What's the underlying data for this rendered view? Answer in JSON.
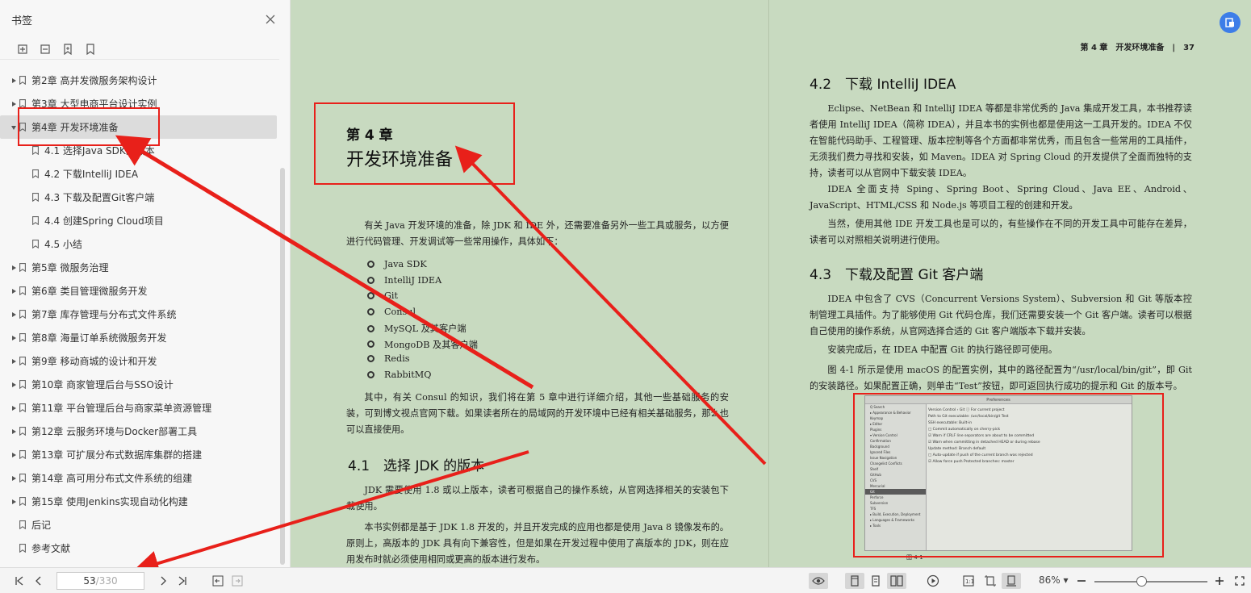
{
  "sidebar": {
    "title": "书签",
    "items": [
      {
        "label": "第2章 高并发微服务架构设计",
        "level": 0,
        "expandable": true
      },
      {
        "label": "第3章 大型电商平台设计实例",
        "level": 0,
        "expandable": true
      },
      {
        "label": "第4章 开发环境准备",
        "level": 0,
        "expandable": true,
        "expanded": true,
        "active": true
      },
      {
        "label": "4.1 选择Java SDK的版本",
        "level": 1
      },
      {
        "label": "4.2 下载IntelliJ IDEA",
        "level": 1
      },
      {
        "label": "4.3 下载及配置Git客户端",
        "level": 1
      },
      {
        "label": "4.4 创建Spring Cloud项目",
        "level": 1
      },
      {
        "label": "4.5 小结",
        "level": 1
      },
      {
        "label": "第5章 微服务治理",
        "level": 0,
        "expandable": true
      },
      {
        "label": "第6章 类目管理微服务开发",
        "level": 0,
        "expandable": true
      },
      {
        "label": "第7章 库存管理与分布式文件系统",
        "level": 0,
        "expandable": true
      },
      {
        "label": "第8章 海量订单系统微服务开发",
        "level": 0,
        "expandable": true
      },
      {
        "label": "第9章 移动商城的设计和开发",
        "level": 0,
        "expandable": true
      },
      {
        "label": "第10章 商家管理后台与SSO设计",
        "level": 0,
        "expandable": true
      },
      {
        "label": "第11章 平台管理后台与商家菜单资源管理",
        "level": 0,
        "expandable": true
      },
      {
        "label": "第12章 云服务环境与Docker部署工具",
        "level": 0,
        "expandable": true
      },
      {
        "label": "第13章 可扩展分布式数据库集群的搭建",
        "level": 0,
        "expandable": true
      },
      {
        "label": "第14章 高可用分布式文件系统的组建",
        "level": 0,
        "expandable": true
      },
      {
        "label": "第15章 使用Jenkins实现自动化构建",
        "level": 0,
        "expandable": true
      },
      {
        "label": "后记",
        "level": 0,
        "expandable": false
      },
      {
        "label": "参考文献",
        "level": 0,
        "expandable": false
      }
    ]
  },
  "left_page": {
    "chapter_number": "第 4 章",
    "chapter_title": "开发环境准备",
    "intro": "有关 Java 开发环境的准备，除 JDK 和 IDE 外，还需要准备另外一些工具或服务，以方便进行代码管理、开发调试等一些常用操作，具体如下：",
    "bullets": [
      "Java SDK",
      "IntelliJ IDEA",
      "Git",
      "Consul",
      "MySQL 及其客户端",
      "MongoDB 及其客户端",
      "Redis",
      "RabbitMQ"
    ],
    "after_bullets": "其中，有关 Consul 的知识，我们将在第 5 章中进行详细介绍，其他一些基础服务的安装，可到博文视点官网下载。如果读者所在的局域网的开发环境中已经有相关基础服务，那么也可以直接使用。",
    "section_41_title": "4.1　选择 JDK 的版本",
    "section_41_p1": "JDK 需要使用 1.8 或以上版本，读者可根据自己的操作系统，从官网选择相关的安装包下载使用。",
    "section_41_p2": "本书实例都是基于 JDK 1.8 开发的，并且开发完成的应用也都是使用 Java 8 镜像发布的。原则上，高版本的 JDK 具有向下兼容性，但是如果在开发过程中使用了高版本的 JDK，则在应用发布时就必须使用相同或更高的版本进行发布。"
  },
  "right_page": {
    "running_head": "第 4 章　开发环境准备　|　37",
    "section_42_title": "4.2　下载 IntelliJ IDEA",
    "p1": "Eclipse、NetBean 和 IntelliJ IDEA 等都是非常优秀的 Java 集成开发工具，本书推荐读者使用 IntelliJ IDEA（简称 IDEA），并且本书的实例也都是使用这一工具开发的。IDEA 不仅在智能代码助手、工程管理、版本控制等各个方面都非常优秀，而且包含一些常用的工具插件，无须我们费力寻找和安装，如 Maven。IDEA 对 Spring Cloud 的开发提供了全面而独特的支持，读者可以从官网中下载安装 IDEA。",
    "p2": "IDEA 全面支持 Sping、Spring Boot、Spring Cloud、Java EE、Android、JavaScript、HTML/CSS 和 Node.js 等项目工程的创建和开发。",
    "p3": "当然，使用其他 IDE 开发工具也是可以的，有些操作在不同的开发工具中可能存在差异，读者可以对照相关说明进行使用。",
    "section_43_title": "4.3　下载及配置 Git 客户端",
    "p4": "IDEA 中包含了 CVS（Concurrent Versions System）、Subversion 和 Git 等版本控制管理工具插件。为了能够使用 Git 代码仓库，我们还需要安装一个 Git 客户端。读者可以根据自己使用的操作系统，从官网选择合适的 Git 客户端版本下载并安装。",
    "p5": "安装完成后，在 IDEA 中配置 Git 的执行路径即可使用。",
    "p6": "图 4-1 所示是使用 macOS 的配置实例，其中的路径配置为“/usr/local/bin/git”，即 Git 的安装路径。如果配置正确，则单击“Test”按钮，即可返回执行成功的提示和 Git 的版本号。",
    "figure_caption": "图 4-1",
    "figure": {
      "window_title": "Preferences",
      "sidebar": [
        "Q Search",
        "▸ Appearance & Behavior",
        "Keymap",
        "▸ Editor",
        "Plugins",
        "▾ Version Control",
        "Confirmation",
        "Background",
        "Ignored Files",
        "Issue Navigation",
        "Changelist Conflicts",
        "Shelf",
        "GitHub",
        "CVS",
        "Mercurial",
        "Git",
        "Perforce",
        "Subversion",
        "TFS",
        "▸ Build, Execution, Deployment",
        "▸ Languages & Frameworks",
        "▸ Tools"
      ],
      "main": [
        "Version Control › Git   ⓘ For current project",
        "Path to Git executable: /usr/local/bin/git        Test",
        "SSH executable: Built-in",
        "□ Commit automatically on cherry-pick",
        "☑ Warn if CRLF line separators are about to be committed",
        "☑ Warn when committing in detached HEAD or during rebase",
        "Update method: Branch default",
        "□ Auto-update if push of the current branch was rejected",
        "☑ Allow force push     Protected branches: master"
      ]
    }
  },
  "toolbar": {
    "current_page": "53",
    "total_pages": "/330",
    "zoom": "86%"
  },
  "colors": {
    "page_bg": "#c8dac0",
    "annotation_red": "#e8201a",
    "accent_blue": "#3d7de8"
  }
}
